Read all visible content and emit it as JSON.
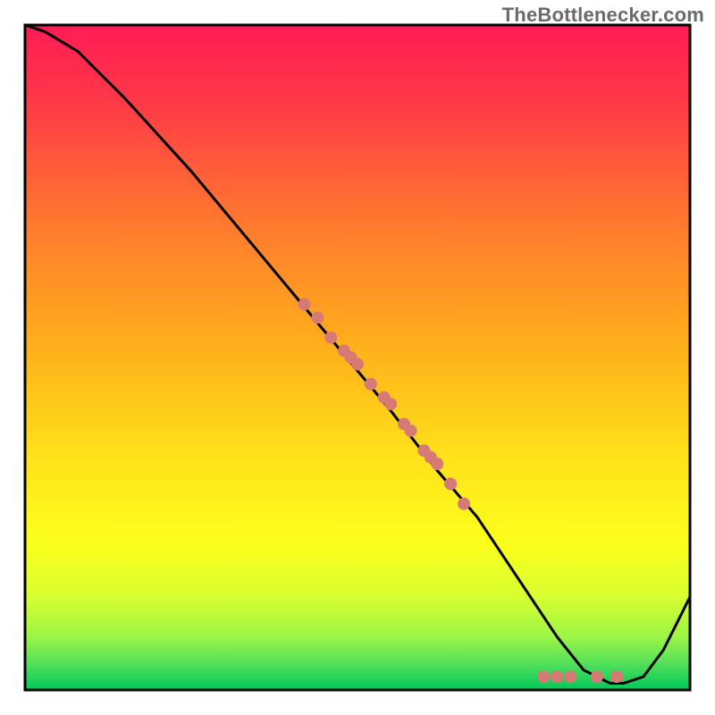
{
  "watermark_text": "TheBottlenecker.com",
  "chart_data": {
    "type": "line",
    "title": "",
    "xlabel": "",
    "ylabel": "",
    "xlim": [
      0,
      100
    ],
    "ylim": [
      0,
      100
    ],
    "axes_visible": false,
    "grid": false,
    "background_gradient": {
      "top_color": "#ff1c55",
      "mid_color": "#ffe800",
      "bottom_color": "#00c85a",
      "note": "vertical gradient (red at top to green at bottom) inside plot area"
    },
    "series": [
      {
        "name": "curve",
        "color": "#000000",
        "x": [
          0,
          3,
          8,
          15,
          25,
          35,
          45,
          55,
          62,
          68,
          72,
          76,
          80,
          84,
          88,
          90,
          93,
          96,
          100
        ],
        "y": [
          100,
          99,
          96,
          89,
          78,
          66,
          54,
          42,
          33,
          26,
          20,
          14,
          8,
          3,
          1,
          1,
          2,
          6,
          14
        ]
      },
      {
        "name": "mid-points",
        "type": "scatter",
        "color": "#d77a76",
        "x": [
          42,
          44,
          46,
          48,
          49,
          50,
          52,
          54,
          55,
          57,
          58,
          60,
          61,
          62,
          64,
          66
        ],
        "y": [
          58,
          56,
          53,
          51,
          50,
          49,
          46,
          44,
          43,
          40,
          39,
          36,
          35,
          34,
          31,
          28
        ]
      },
      {
        "name": "bottom-points",
        "type": "scatter",
        "color": "#d77a76",
        "x": [
          78,
          80,
          82,
          86,
          89
        ],
        "y": [
          2,
          2,
          2,
          2,
          2
        ]
      }
    ]
  },
  "colors": {
    "marker": "#d77a76",
    "line": "#000000"
  }
}
